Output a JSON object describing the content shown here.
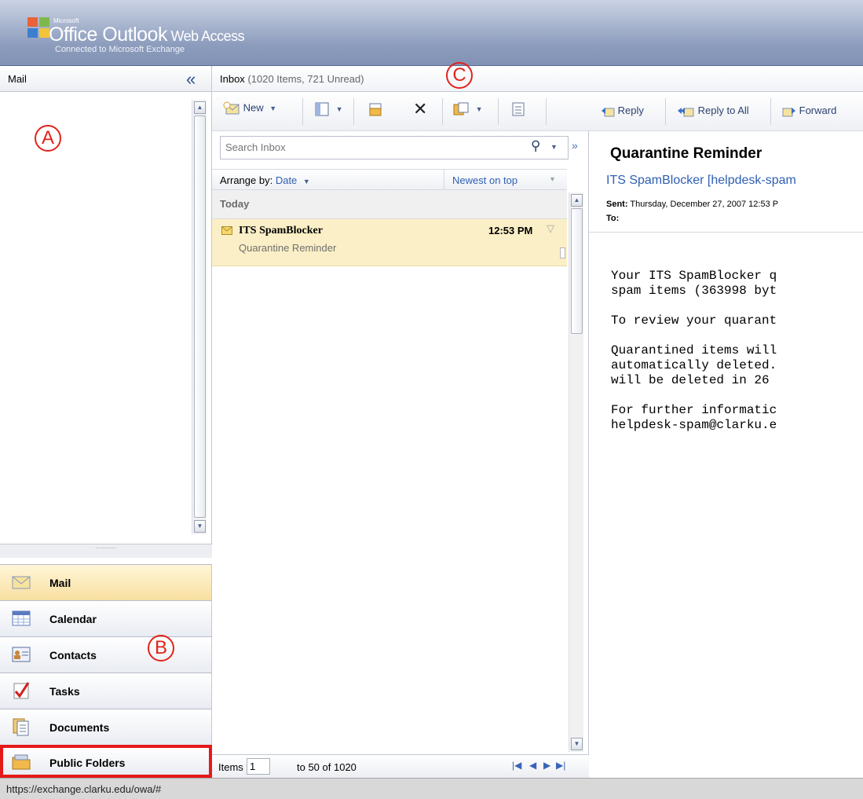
{
  "header": {
    "microsoft": "Microsoft",
    "title_main": "Office Outlook",
    "title_web": " Web Access",
    "subtitle": "Connected to Microsoft Exchange"
  },
  "mail_header": {
    "label": "Mail"
  },
  "inbox_header": {
    "title": "Inbox",
    "count": "(1020 Items, 721 Unread)"
  },
  "callouts": {
    "a": "A",
    "b": "B",
    "c": "C"
  },
  "nav": [
    {
      "label": "Mail",
      "icon": "mail-icon"
    },
    {
      "label": "Calendar",
      "icon": "calendar-icon"
    },
    {
      "label": "Contacts",
      "icon": "contacts-icon"
    },
    {
      "label": "Tasks",
      "icon": "tasks-icon"
    },
    {
      "label": "Documents",
      "icon": "documents-icon"
    },
    {
      "label": "Public Folders",
      "icon": "public-folders-icon"
    }
  ],
  "list_toolbar": {
    "new_label": "New"
  },
  "search": {
    "placeholder": "Search Inbox"
  },
  "arrange": {
    "label": "Arrange by:",
    "value": "Date",
    "sort": "Newest on top"
  },
  "groups": {
    "today": "Today"
  },
  "message": {
    "from": "ITS SpamBlocker",
    "time": "12:53 PM",
    "subject": "Quarantine Reminder"
  },
  "list_footer": {
    "items_label": "Items",
    "items_value": "1",
    "range": "to 50 of 1020"
  },
  "read_toolbar": {
    "reply": "Reply",
    "reply_all": "Reply to All",
    "forward": "Forward"
  },
  "reading": {
    "subject": "Quarantine Reminder",
    "sender": "ITS SpamBlocker [helpdesk-spam",
    "sent_label": "Sent:",
    "sent_value": "Thursday, December 27, 2007 12:53 P",
    "to_label": "To:",
    "body": "Your ITS SpamBlocker q\nspam items (363998 byt\n\nTo review your quarant\n\nQuarantined items will\nautomatically deleted.\nwill be deleted in 26 \n\nFor further informatic\nhelpdesk-spam@clarku.e"
  },
  "status_bar": {
    "url": "https://exchange.clarku.edu/owa/#"
  },
  "colors": {
    "header": "#8c9cbc",
    "accent": "#2f5fb3",
    "selected_row": "#fbefc7",
    "callout": "#e2231a"
  }
}
